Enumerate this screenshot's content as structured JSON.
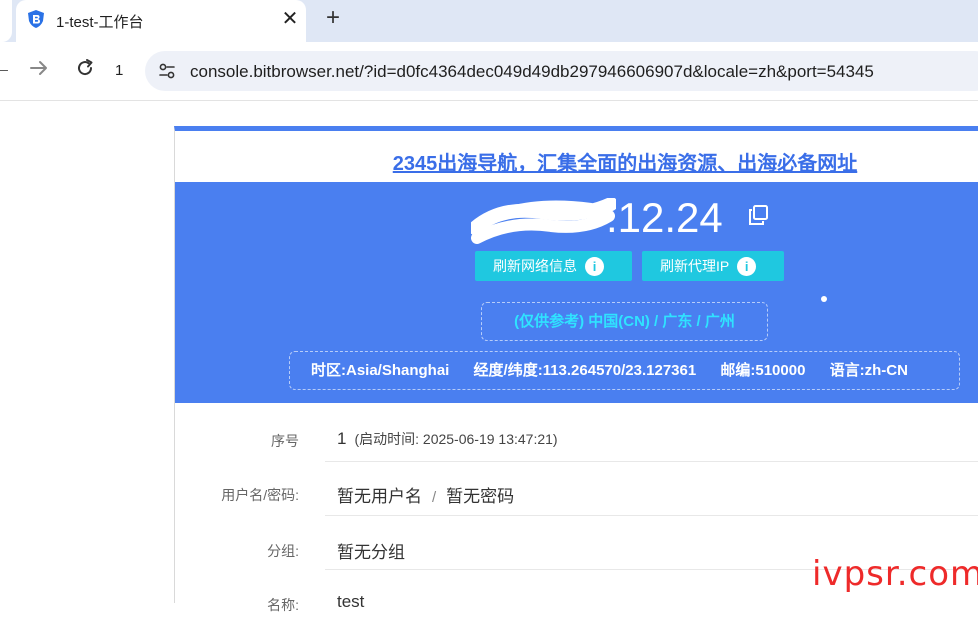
{
  "browser": {
    "tab": {
      "title": "1-test-工作台"
    },
    "new_tab_label": "+",
    "tab_count": "1",
    "url": "console.bitbrowser.net/?id=d0fc4364dec049d49db297946606907d&locale=zh&port=54345"
  },
  "page": {
    "promo_link": "2345出海导航，汇集全面的出海资源、出海必备网址",
    "ip_suffix": ".12.24",
    "buttons": {
      "refresh_network": "刷新网络信息",
      "refresh_proxy": "刷新代理IP",
      "info_glyph": "i"
    },
    "geo": "(仅供参考)  中国(CN) / 广东 / 广州",
    "meta": {
      "timezone": "时区:Asia/Shanghai",
      "coords": "经度/纬度:113.264570/23.127361",
      "zip": "邮编:510000",
      "lang": "语言:zh-CN"
    },
    "rows": {
      "seq_label": "序号",
      "seq_value": "1",
      "seq_start": "(启动时间: 2025-06-19 13:47:21)",
      "cred_label": "用户名/密码:",
      "cred_user": "暂无用户名",
      "cred_sep": "/",
      "cred_pass": "暂无密码",
      "group_label": "分组:",
      "group_value": "暂无分组",
      "name_label": "名称:",
      "name_value": "test"
    }
  },
  "watermark": "ivpsr.com",
  "colors": {
    "banner": "#4a7ff0",
    "button": "#1fc8e0",
    "geo_text": "#2fe3ff",
    "link": "#3a6ee8",
    "watermark": "#ee2a2a"
  }
}
